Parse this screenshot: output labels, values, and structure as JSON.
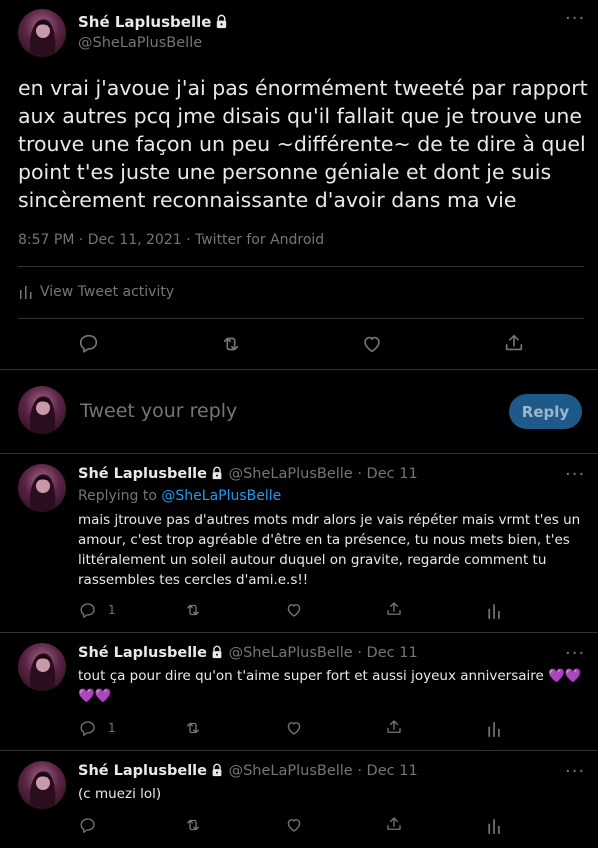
{
  "main_tweet": {
    "author_name": "Shé Laplusbelle",
    "author_handle": "@SheLaPlusBelle",
    "text_lines": [
      "en vrai j'avoue j'ai pas énormément tweeté par rapport",
      "aux autres pcq jme disais qu'il fallait que je trouve une",
      "trouve une façon un peu ~différente~ de te dire à quel",
      "point t'es juste une personne géniale et dont je suis",
      "sincèrement reconnaissante d'avoir dans ma vie"
    ],
    "timestamp": "8:57 PM · Dec 11, 2021 · Twitter for Android",
    "activity_label": "View Tweet activity"
  },
  "compose": {
    "placeholder": "Tweet your reply",
    "button_label": "Reply"
  },
  "replies": [
    {
      "author_name": "Shé Laplusbelle",
      "author_handle": "@SheLaPlusBelle",
      "date": "· Dec 11",
      "replying_to_label": "Replying to",
      "replying_to_handle": "@SheLaPlusBelle",
      "text_lines": [
        "mais jtrouve pas d'autres mots mdr alors je vais répéter mais vrmt t'es un",
        "amour, c'est trop agréable d'être en ta présence, tu nous mets bien, t'es",
        "littéralement un soleil autour duquel on gravite, regarde comment tu",
        "rassembles tes cercles d'ami.e.s!!"
      ],
      "reply_count": "1"
    },
    {
      "author_name": "Shé Laplusbelle",
      "author_handle": "@SheLaPlusBelle",
      "date": "· Dec 11",
      "text_lines": [
        "tout ça pour dire qu'on t'aime super fort et aussi joyeux anniversaire 💜💜",
        "💜💜"
      ],
      "reply_count": "1"
    },
    {
      "author_name": "Shé Laplusbelle",
      "author_handle": "@SheLaPlusBelle",
      "date": "· Dec 11",
      "text_lines": [
        "(c muezi lol)"
      ],
      "reply_count": ""
    }
  ],
  "colors": {
    "background": "#000000",
    "text": "#e7e9ea",
    "muted": "#71767b",
    "link": "#1d9bf0",
    "divider": "#2f3336",
    "reply_button": "#1d5a8a"
  },
  "icons": {
    "more": "more-dots-icon",
    "lock": "lock-icon",
    "reply": "reply-icon",
    "retweet": "retweet-icon",
    "like": "heart-icon",
    "share": "share-icon",
    "analytics": "analytics-icon"
  }
}
